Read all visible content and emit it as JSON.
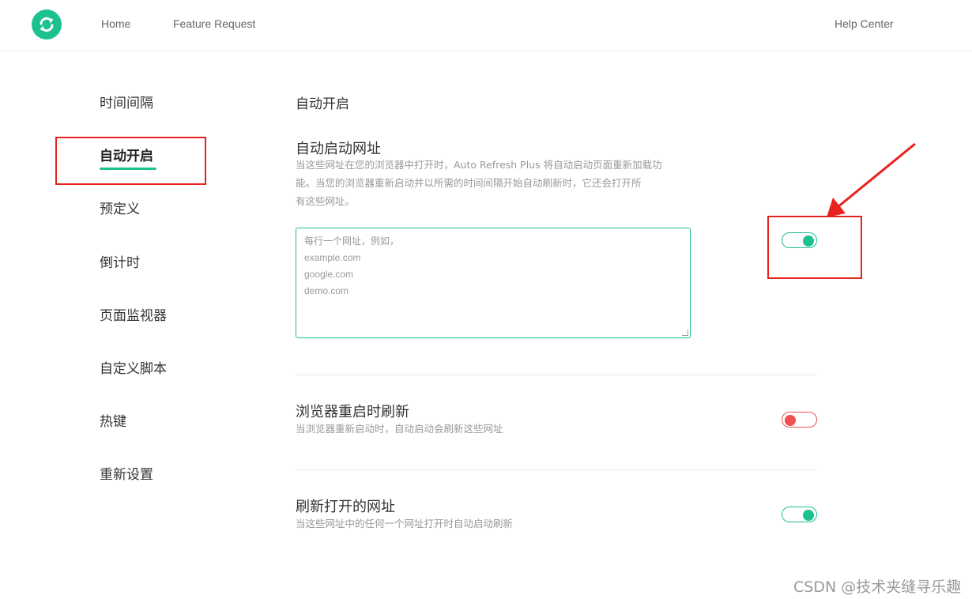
{
  "header": {
    "nav": [
      "Home",
      "Feature Request"
    ],
    "help": "Help Center"
  },
  "sidebar": {
    "items": [
      "时间间隔",
      "自动开启",
      "预定义",
      "倒计时",
      "页面监视器",
      "自定义脚本",
      "热键",
      "重新设置"
    ],
    "active_index": 1
  },
  "main": {
    "section_title": "自动开启",
    "auto_start": {
      "title": "自动启动网址",
      "description": [
        "当这些网址在您的浏览器中打开时，Auto Refresh Plus 将自动启动页面重新加载功",
        "能。当您的浏览器重新启动并以所需的时间间隔开始自动刷新时，它还会打开所",
        "有这些网址。"
      ],
      "placeholder_lines": [
        "每行一个网址，例如，",
        "example.com",
        "google.com",
        "demo.com"
      ],
      "toggle": "on"
    },
    "browser_restart": {
      "title": "浏览器重启时刷新",
      "description": "当浏览器重新启动时，自动启动会刷新这些网址",
      "toggle": "off"
    },
    "refresh_open": {
      "title": "刷新打开的网址",
      "description": "当这些网址中的任何一个网址打开时自动启动刷新",
      "toggle": "on"
    }
  },
  "watermark": "CSDN @技术夹缝寻乐趣",
  "colors": {
    "accent": "#1bc18f",
    "off": "#f05050",
    "annotation": "#e8221e"
  }
}
